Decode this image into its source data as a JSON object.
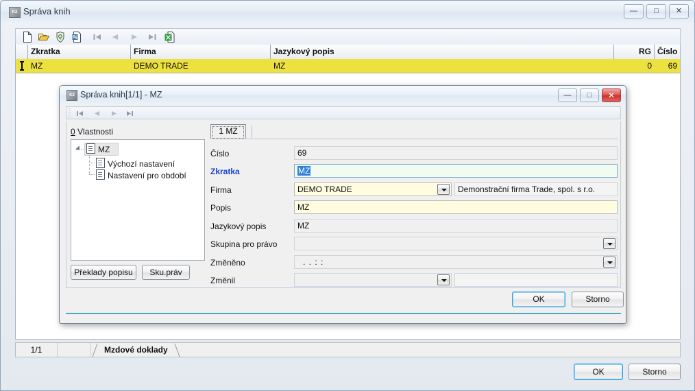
{
  "main_window": {
    "title": "Správa knih",
    "icon": "app-icon",
    "window_controls": [
      {
        "name": "minimize",
        "glyph": "—"
      },
      {
        "name": "maximize",
        "glyph": "□"
      },
      {
        "name": "close",
        "glyph": "✕"
      }
    ],
    "toolbar": [
      {
        "name": "new-record-icon",
        "title": "Nový"
      },
      {
        "name": "open-folder-icon",
        "title": "Otevřít"
      },
      {
        "name": "shield-lock-icon",
        "title": "Práva"
      },
      {
        "name": "refresh-document-icon",
        "title": "Obnovit"
      },
      {
        "name": "first-record-icon",
        "title": "První"
      },
      {
        "name": "previous-record-icon",
        "title": "Předchozí"
      },
      {
        "name": "next-record-icon",
        "title": "Další"
      },
      {
        "name": "last-record-icon",
        "title": "Poslední"
      },
      {
        "name": "export-excel-icon",
        "title": "Export do Excelu"
      }
    ],
    "grid": {
      "columns": [
        "Zkratka",
        "Firma",
        "Jazykový popis",
        "RG",
        "Číslo"
      ],
      "rows": [
        {
          "Zkratka": "MZ",
          "Firma": "DEMO TRADE",
          "Jazykový popis": "MZ",
          "RG": "0",
          "Číslo": "69"
        }
      ]
    },
    "statusbar": {
      "counter": "1/1",
      "tab": "Mzdové doklady"
    },
    "footer": {
      "ok": "OK",
      "storno": "Storno"
    }
  },
  "dialog": {
    "title": "Správa knih[1/1] - MZ",
    "icon": "app-icon",
    "window_controls": [
      {
        "name": "minimize",
        "glyph": "—"
      },
      {
        "name": "maximize",
        "glyph": "□"
      },
      {
        "name": "close",
        "glyph": "✕"
      }
    ],
    "nav_toolbar": [
      {
        "name": "first-record-icon"
      },
      {
        "name": "previous-record-icon"
      },
      {
        "name": "next-record-icon"
      },
      {
        "name": "last-record-icon"
      }
    ],
    "tree": {
      "label_accel": "0",
      "label": " Vlastnosti",
      "nodes": [
        {
          "label": "MZ",
          "icon": "document-icon",
          "selected": true
        },
        {
          "label": "Výchozí nastavení",
          "icon": "document-icon",
          "selected": false
        },
        {
          "label": "Nastavení pro období",
          "icon": "documents-icon",
          "selected": false
        }
      ]
    },
    "left_buttons": {
      "preklady": "Překlady popisu",
      "skuprav": "Sku.práv"
    },
    "tabs": [
      {
        "label": "1 MZ",
        "active": true
      }
    ],
    "form": [
      {
        "label": "Číslo",
        "value": "69",
        "style": "readonly",
        "required": false,
        "dropdown": false
      },
      {
        "label": "Zkratka",
        "value": "MZ",
        "style": "focus",
        "required": true,
        "dropdown": false,
        "selected": true
      },
      {
        "label": "Firma",
        "value": "DEMO TRADE",
        "style": "edit",
        "required": false,
        "dropdown": true,
        "aux": "Demonstrační firma Trade, spol. s r.o."
      },
      {
        "label": "Popis",
        "value": "MZ",
        "style": "edit",
        "required": false,
        "dropdown": false
      },
      {
        "label": "Jazykový popis",
        "value": "MZ",
        "style": "readonly",
        "required": false,
        "dropdown": false
      },
      {
        "label": "Skupina pro právo",
        "value": "",
        "style": "readonly",
        "required": false,
        "dropdown": false
      },
      {
        "label": "Změněno",
        "value": " .  .      :  :",
        "style": "readonly",
        "required": false,
        "dropdown": true
      },
      {
        "label": "Změnil",
        "value": "",
        "style": "readonly",
        "required": false,
        "dropdown": true,
        "aux": ""
      }
    ],
    "footer": {
      "ok": "OK",
      "storno": "Storno"
    }
  },
  "colors": {
    "row_highlight": "#ece13f",
    "required_label": "#1a3fd0",
    "selection": "#2f7fd6",
    "close_button": "#c9302c",
    "focus_border": "#3c9de0",
    "edit_field": "#fffce0",
    "focus_field": "#f2fbef"
  }
}
